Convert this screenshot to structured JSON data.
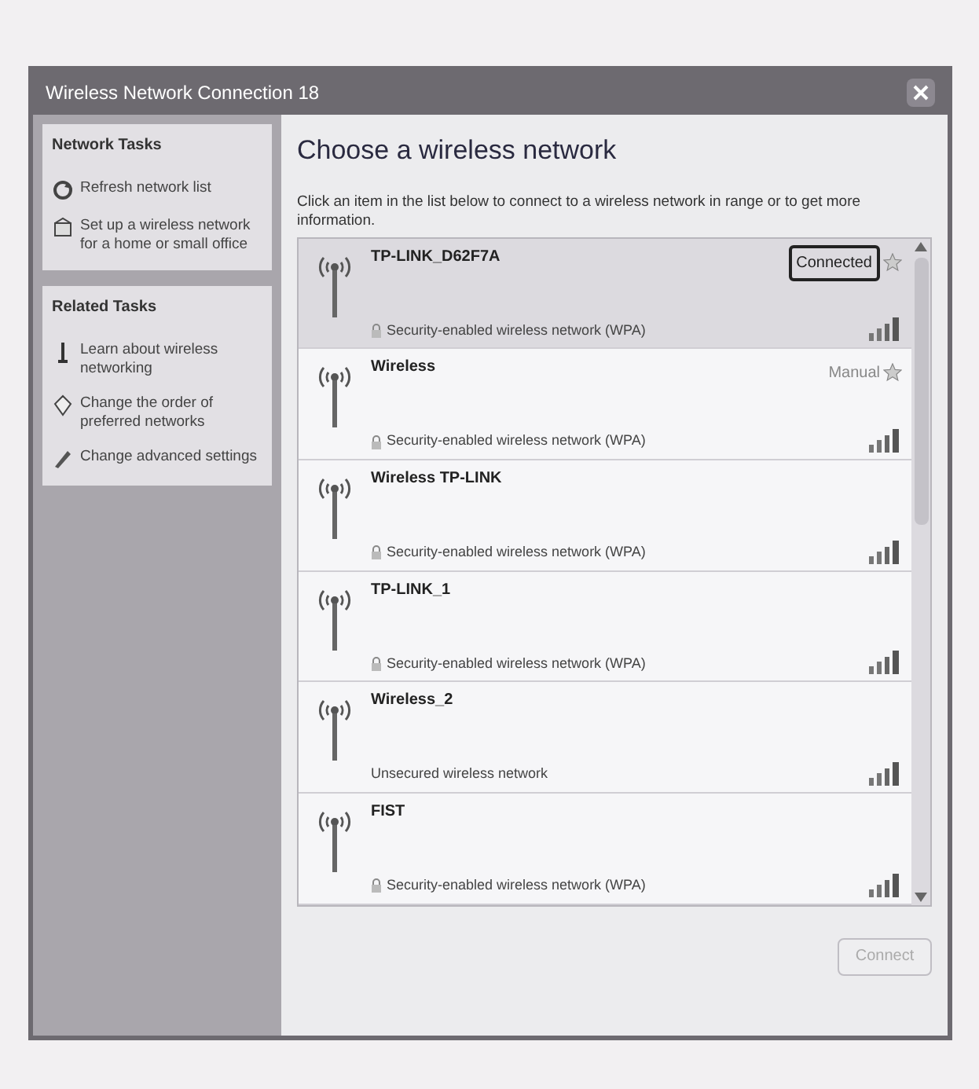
{
  "window": {
    "title": "Wireless Network Connection 18"
  },
  "sidebar": {
    "sections": [
      {
        "title": "Network Tasks",
        "items": [
          {
            "label": "Refresh network list"
          },
          {
            "label": "Set up a wireless network for a home or small office"
          }
        ]
      },
      {
        "title": "Related Tasks",
        "items": [
          {
            "label": "Learn about wireless networking"
          },
          {
            "label": "Change the order of preferred networks"
          },
          {
            "label": "Change advanced settings"
          }
        ]
      }
    ]
  },
  "heading": "Choose a wireless network",
  "instructions": "Click an item in the list below to connect to a wireless network in range or to get more information.",
  "networks": [
    {
      "name": "TP-LINK_D62F7A",
      "security": "Security-enabled wireless network (WPA)",
      "status": "Connected",
      "secured": true,
      "selected": true
    },
    {
      "name": "Wireless",
      "security": "Security-enabled wireless network (WPA)",
      "status": "Manual",
      "secured": true,
      "selected": false
    },
    {
      "name": "Wireless TP-LINK",
      "security": "Security-enabled wireless network (WPA)",
      "secured": true,
      "selected": false
    },
    {
      "name": "TP-LINK_1",
      "security": "Security-enabled wireless network (WPA)",
      "secured": true,
      "selected": false
    },
    {
      "name": "Wireless_2",
      "security": "Unsecured wireless network",
      "secured": false,
      "selected": false
    },
    {
      "name": "FIST",
      "security": "Security-enabled wireless network (WPA)",
      "secured": true,
      "selected": false
    }
  ],
  "connect_button": {
    "label": "Connect",
    "disabled": true
  }
}
